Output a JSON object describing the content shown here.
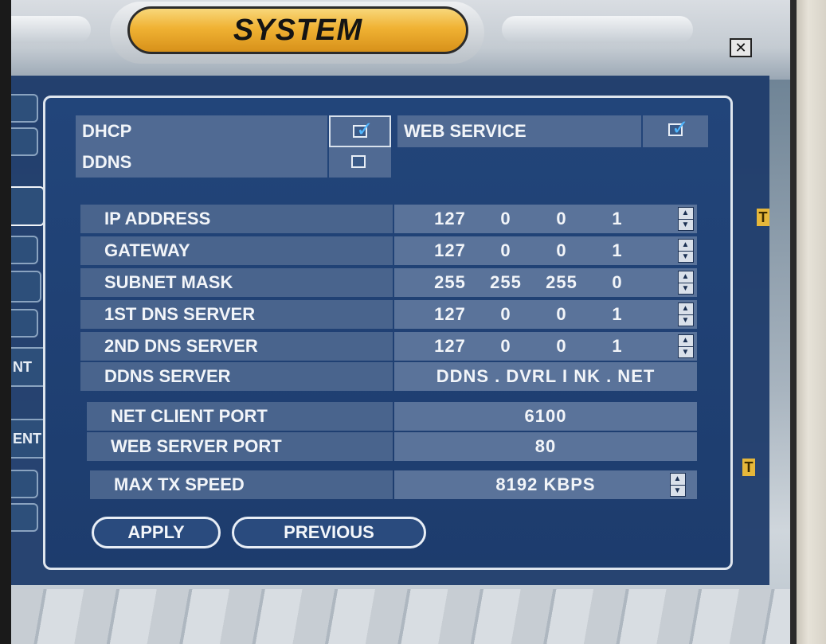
{
  "header": {
    "title": "SYSTEM",
    "close_glyph": "✕"
  },
  "sidebar": {
    "stub_labels": [
      "NT",
      "ENT"
    ]
  },
  "toggles": {
    "dhcp": {
      "label": "DHCP",
      "checked": true
    },
    "ddns": {
      "label": "DDNS",
      "checked": false
    },
    "web_service": {
      "label": "WEB SERVICE",
      "checked": true
    },
    "check_glyph": "✓"
  },
  "network_rows": [
    {
      "label": "IP ADDRESS",
      "octets": [
        "127",
        "0",
        "0",
        "1"
      ]
    },
    {
      "label": "GATEWAY",
      "octets": [
        "127",
        "0",
        "0",
        "1"
      ]
    },
    {
      "label": "SUBNET MASK",
      "octets": [
        "255",
        "255",
        "255",
        "0"
      ]
    },
    {
      "label": "1ST DNS SERVER",
      "octets": [
        "127",
        "0",
        "0",
        "1"
      ]
    },
    {
      "label": "2ND DNS SERVER",
      "octets": [
        "127",
        "0",
        "0",
        "1"
      ]
    }
  ],
  "ddns_server": {
    "label": "DDNS SERVER",
    "value": "DDNS . DVRL I NK . NET"
  },
  "ports": {
    "net_client": {
      "label": "NET CLIENT PORT",
      "value": "6100"
    },
    "web_server": {
      "label": "WEB SERVER PORT",
      "value": "80"
    }
  },
  "max_tx": {
    "label": "MAX TX SPEED",
    "value": "8192  KBPS"
  },
  "buttons": {
    "apply": "APPLY",
    "previous": "PREVIOUS"
  },
  "markers": {
    "t": "T"
  },
  "spinner_glyphs": {
    "up": "▲",
    "down": "▼"
  },
  "colors": {
    "panel": "#1f3c6b",
    "row_label": "#49648d",
    "row_value": "#5a739a",
    "title_gold": "#f0b233",
    "check_blue": "#4fb7ff"
  }
}
